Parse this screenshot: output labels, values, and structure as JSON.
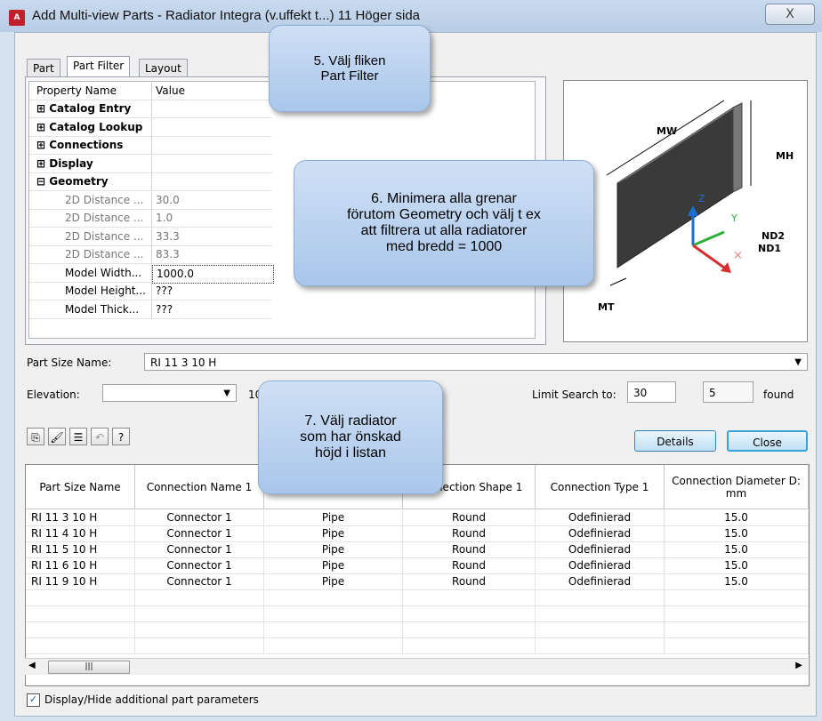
{
  "window": {
    "title": "Add Multi-view Parts - Radiator Integra (v.uffekt t...) 11 Höger sida",
    "close_glyph": "X",
    "app_icon": "autocad-mep-icon"
  },
  "tabs": [
    {
      "label": "Part"
    },
    {
      "label": "Part Filter"
    },
    {
      "label": "Layout"
    }
  ],
  "property_grid": {
    "header": {
      "name": "Property Name",
      "value": "Value"
    },
    "rows": [
      {
        "name": "⊞ Catalog Entry",
        "value": "",
        "style": "bold"
      },
      {
        "name": "⊞ Catalog Lookup",
        "value": "",
        "style": "bold"
      },
      {
        "name": "⊞ Connections",
        "value": "",
        "style": "bold"
      },
      {
        "name": "⊞ Display",
        "value": "",
        "style": "bold"
      },
      {
        "name": "⊟ Geometry",
        "value": "",
        "style": "bold"
      },
      {
        "name": "2D Distance ...",
        "value": "30.0",
        "style": "dim"
      },
      {
        "name": "2D Distance ...",
        "value": "1.0",
        "style": "dim"
      },
      {
        "name": "2D Distance ...",
        "value": "33.3",
        "style": "dim"
      },
      {
        "name": "2D Distance ...",
        "value": "83.3",
        "style": "dim"
      },
      {
        "name": "Model Width...",
        "value": "1000.0",
        "style": "normal"
      },
      {
        "name": "Model Height...",
        "value": "???",
        "style": "normal"
      },
      {
        "name": "Model Thick...",
        "value": "???",
        "style": "normal"
      }
    ]
  },
  "preview": {
    "labels": {
      "mw": "MW",
      "mh": "MH",
      "mt": "MT",
      "nd1": "ND1",
      "nd2": "ND2",
      "z": "Z",
      "y": "Y"
    }
  },
  "part_size": {
    "label": "Part Size Name:",
    "value": "RI 11 3  10 H"
  },
  "elevation": {
    "label": "Elevation:",
    "value": "",
    "offset": "10"
  },
  "limit": {
    "label": "Limit Search to:",
    "value": "30",
    "found_count": "5",
    "found_label": "found"
  },
  "buttons": {
    "details": "Details",
    "close": "Close"
  },
  "toolbar": {
    "help": "?"
  },
  "table": {
    "columns": [
      "Part Size Name",
      "Connection Name 1",
      "",
      "Connection Shape 1",
      "Connection Type 1",
      "Connection Diameter D: mm"
    ],
    "rows": [
      [
        "RI 11 3  10 H",
        "Connector 1",
        "Pipe",
        "Round",
        "Odefinierad",
        "15.0"
      ],
      [
        "RI 11 4  10 H",
        "Connector 1",
        "Pipe",
        "Round",
        "Odefinierad",
        "15.0"
      ],
      [
        "RI 11 5  10 H",
        "Connector 1",
        "Pipe",
        "Round",
        "Odefinierad",
        "15.0"
      ],
      [
        "RI 11 6  10 H",
        "Connector 1",
        "Pipe",
        "Round",
        "Odefinierad",
        "15.0"
      ],
      [
        "RI 11 9  10 H",
        "Connector 1",
        "Pipe",
        "Round",
        "Odefinierad",
        "15.0"
      ]
    ]
  },
  "checkbox": {
    "label": "Display/Hide additional part parameters",
    "checked": true
  },
  "callouts": [
    {
      "text": "5. Välj fliken\nPart Filter"
    },
    {
      "text": "6. Minimera alla grenar\nförutom Geometry och välj t ex\natt filtrera ut alla  radiatorer\nmed bredd = 1000"
    },
    {
      "text": "7. Välj radiator\nsom har önskad\nhöjd i listan"
    }
  ]
}
